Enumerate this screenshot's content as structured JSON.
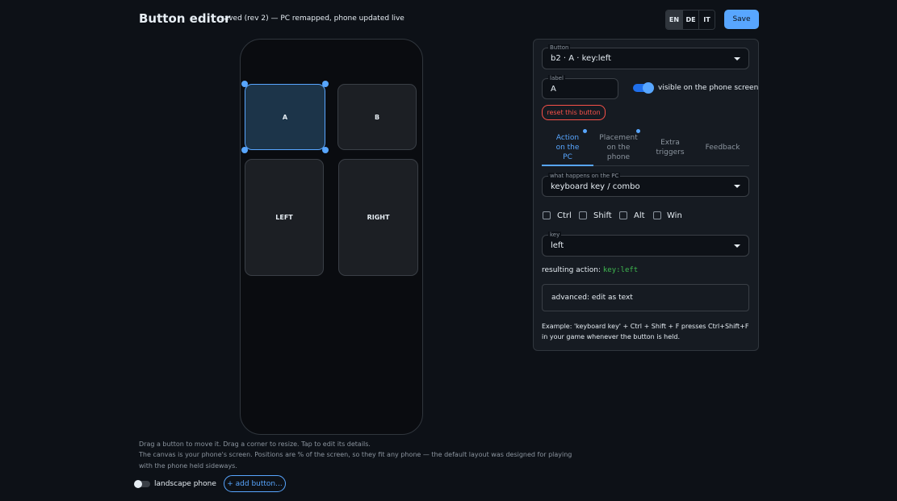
{
  "header": {
    "title": "Button editor",
    "status": "saved (rev 2) — PC remapped, phone updated live",
    "languages": [
      "EN",
      "DE",
      "IT"
    ],
    "active_language": "EN",
    "save_label": "Save"
  },
  "canvas": {
    "buttons": [
      {
        "label": "A",
        "selected": true
      },
      {
        "label": "B",
        "selected": false
      },
      {
        "label": "LEFT",
        "selected": false
      },
      {
        "label": "RIGHT",
        "selected": false
      }
    ],
    "hint_1": "Drag a button to move it. Drag a corner to resize. Tap to edit its details.",
    "hint_2": "The canvas is your phone's screen. Positions are % of the screen, so they fit any phone — the default layout was designed for playing",
    "hint_3": "with the phone held sideways.",
    "landscape_label": "landscape phone",
    "landscape_on": false,
    "add_button_label": "+ add button..."
  },
  "panel": {
    "button_select": {
      "legend": "Button",
      "value": "b2 · A · key:left"
    },
    "label_field": {
      "legend": "label",
      "value": "A"
    },
    "visible_switch": {
      "label": "visible on the phone screen",
      "on": true
    },
    "reset_label": "reset this button",
    "tabs": [
      {
        "line1": "Action",
        "line2": "on the",
        "line3": "PC",
        "active": true,
        "dot": true
      },
      {
        "line1": "Placement",
        "line2": "on the",
        "line3": "phone",
        "active": false,
        "dot": true
      },
      {
        "line1": "Extra",
        "line2": "triggers",
        "line3": "",
        "active": false,
        "dot": false
      },
      {
        "line1": "Feedback",
        "line2": "",
        "line3": "",
        "active": false,
        "dot": false
      }
    ],
    "action_select": {
      "legend": "what happens on the PC",
      "value": "keyboard key / combo"
    },
    "modifiers": [
      "Ctrl",
      "Shift",
      "Alt",
      "Win"
    ],
    "key_select": {
      "legend": "key",
      "value": "left"
    },
    "result_label": "resulting action:",
    "result_code": "key:left",
    "advanced_label": "advanced: edit as text",
    "example_text": "Example: 'keyboard key' + Ctrl + Shift + F presses Ctrl+Shift+F in your game whenever the button is held."
  },
  "colors": {
    "accent": "#58a6ff",
    "danger": "#f85149",
    "success": "#3fb950",
    "background": "#0d1117"
  }
}
